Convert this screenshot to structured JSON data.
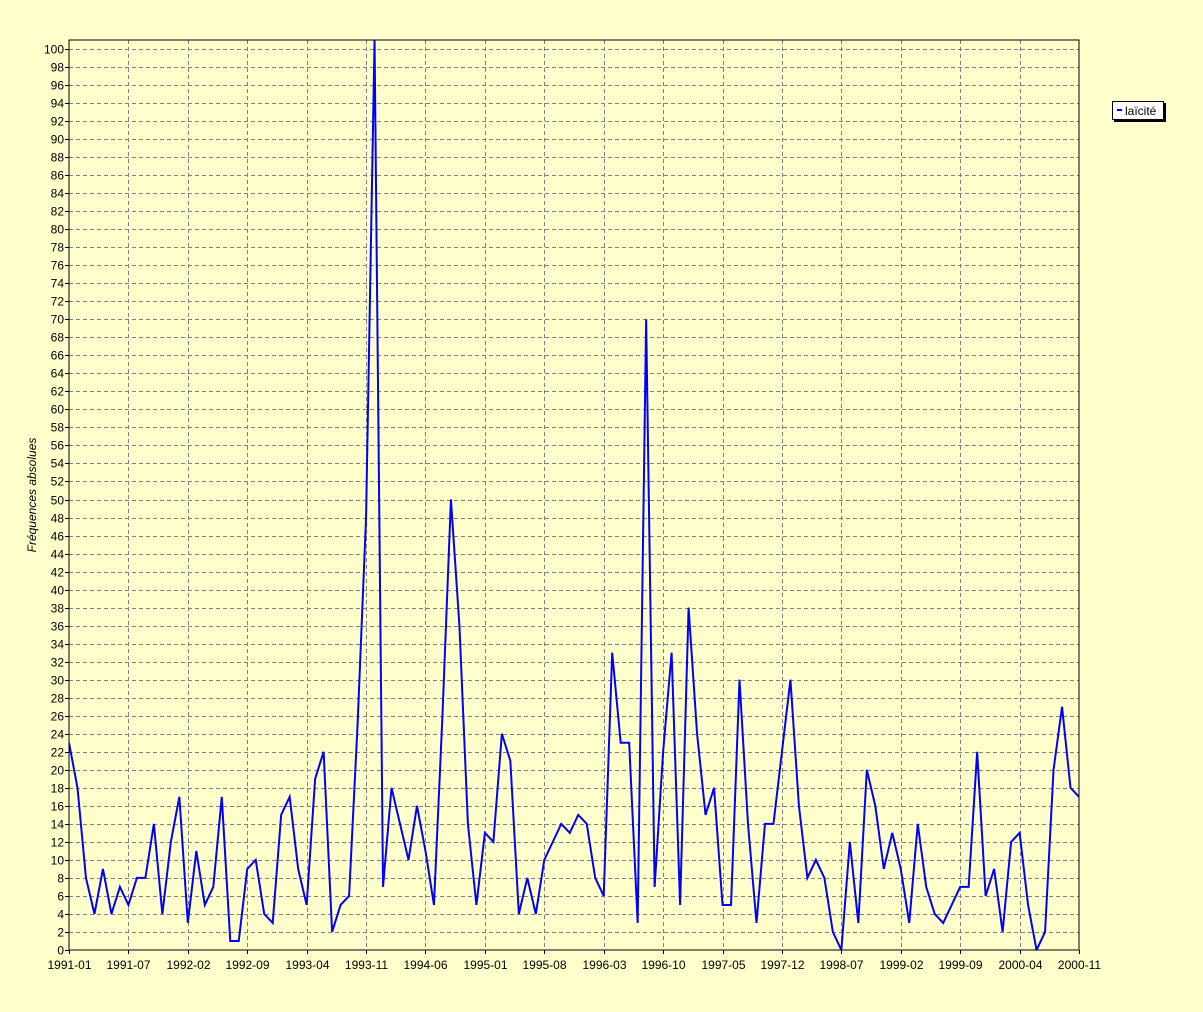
{
  "chart_data": {
    "type": "line",
    "title": "",
    "xlabel": "",
    "ylabel": "Fréquences absolues",
    "ylim": [
      0,
      101
    ],
    "yticks": [
      0,
      2,
      4,
      6,
      8,
      10,
      12,
      14,
      16,
      18,
      20,
      22,
      24,
      26,
      28,
      30,
      32,
      34,
      36,
      38,
      40,
      42,
      44,
      46,
      48,
      50,
      52,
      54,
      56,
      58,
      60,
      62,
      64,
      66,
      68,
      70,
      72,
      74,
      76,
      78,
      80,
      82,
      84,
      86,
      88,
      90,
      92,
      94,
      96,
      98,
      100
    ],
    "grid": true,
    "legend_position": "top-right",
    "x_tick_labels": [
      "1991-01",
      "1991-07",
      "1992-02",
      "1992-09",
      "1993-04",
      "1993-11",
      "1994-06",
      "1995-01",
      "1995-08",
      "1996-03",
      "1996-10",
      "1997-05",
      "1997-12",
      "1998-07",
      "1999-02",
      "1999-09",
      "2000-04",
      "2000-11"
    ],
    "series": [
      {
        "name": "laïcité",
        "color": "#0000ff",
        "values": [
          23,
          18,
          8,
          4,
          9,
          4,
          7,
          5,
          8,
          8,
          14,
          4,
          12,
          17,
          3,
          11,
          5,
          7,
          17,
          1,
          1,
          9,
          10,
          4,
          3,
          15,
          17,
          9,
          5,
          19,
          22,
          2,
          5,
          6,
          25,
          48,
          101,
          7,
          18,
          14,
          10,
          16,
          11,
          5,
          26,
          50,
          36,
          14,
          5,
          13,
          12,
          24,
          21,
          4,
          8,
          4,
          10,
          12,
          14,
          13,
          15,
          14,
          8,
          6,
          33,
          23,
          23,
          3,
          70,
          7,
          22,
          33,
          5,
          38,
          24,
          15,
          18,
          5,
          5,
          30,
          14,
          3,
          14,
          14,
          22,
          30,
          16,
          8,
          10,
          8,
          2,
          0,
          12,
          3,
          20,
          16,
          9,
          13,
          9,
          3,
          14,
          7,
          4,
          3,
          5,
          7,
          7,
          22,
          6,
          9,
          2,
          12,
          13,
          5,
          0,
          2,
          20,
          27,
          18,
          17
        ]
      }
    ]
  }
}
